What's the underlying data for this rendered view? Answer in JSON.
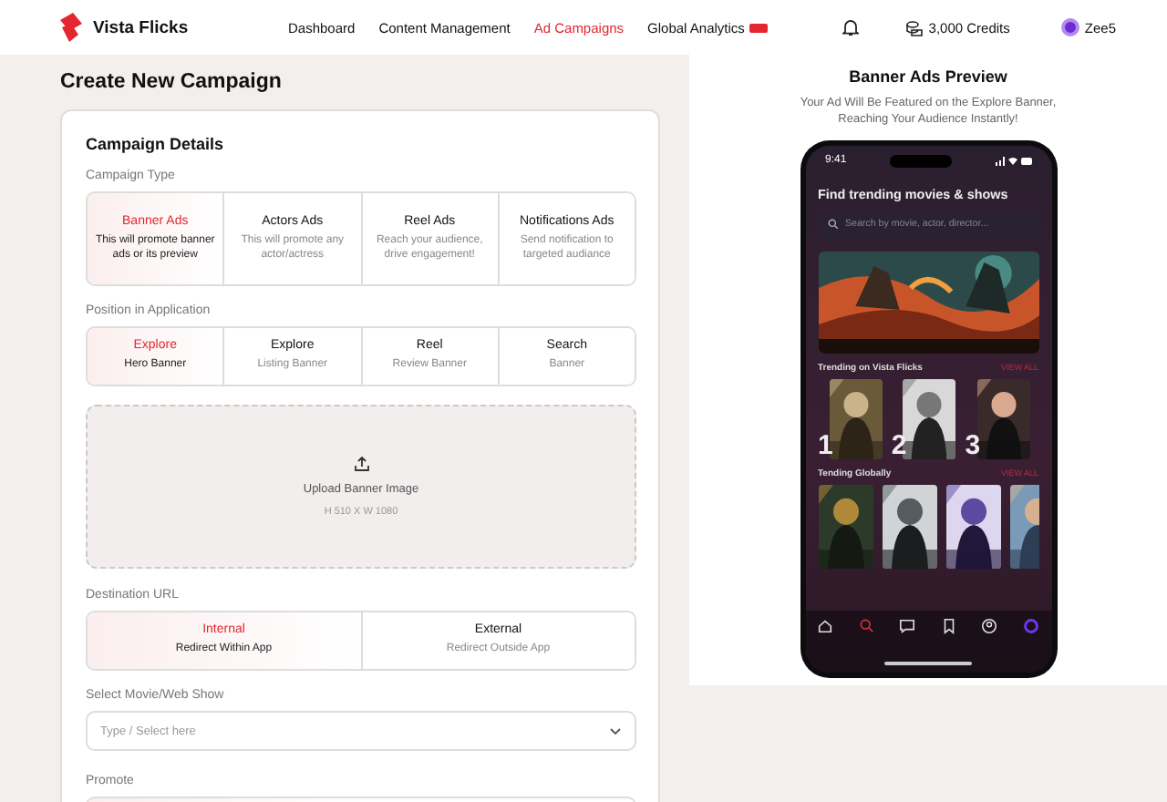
{
  "header": {
    "brand": "Vista Flicks",
    "nav": [
      {
        "label": "Dashboard",
        "selected": false,
        "badge": false
      },
      {
        "label": "Content Management",
        "selected": false,
        "badge": false
      },
      {
        "label": "Ad Campaigns",
        "selected": true,
        "badge": false
      },
      {
        "label": "Global Analytics",
        "selected": false,
        "badge": true
      }
    ],
    "credits": "3,000 Credits",
    "user": "Zee5"
  },
  "page_title": "Create New Campaign",
  "form": {
    "title": "Campaign Details",
    "campaign_type": {
      "label": "Campaign Type",
      "options": [
        {
          "title": "Banner Ads",
          "description": "This will promote banner ads or its preview",
          "selected": true
        },
        {
          "title": "Actors Ads",
          "description": "This will promote any actor/actress",
          "selected": false
        },
        {
          "title": "Reel Ads",
          "description": "Reach your audience, drive engagement!",
          "selected": false
        },
        {
          "title": "Notifications Ads",
          "description": "Send notification to targeted audiance",
          "selected": false
        }
      ]
    },
    "position": {
      "label": "Position in Application",
      "options": [
        {
          "title": "Explore",
          "description": "Hero Banner",
          "selected": true
        },
        {
          "title": "Explore",
          "description": "Listing Banner",
          "selected": false
        },
        {
          "title": "Reel",
          "description": "Review Banner",
          "selected": false
        },
        {
          "title": "Search",
          "description": "Banner",
          "selected": false
        }
      ]
    },
    "upload": {
      "label": "Upload Banner Image",
      "hint": "H 510 X W 1080"
    },
    "destination": {
      "label": "Destination URL",
      "options": [
        {
          "title": "Internal",
          "description": "Redirect Within App",
          "selected": true
        },
        {
          "title": "External",
          "description": "Redirect Outside App",
          "selected": false
        }
      ]
    },
    "select": {
      "label": "Select Movie/Web Show",
      "placeholder": "Type / Select here"
    },
    "promote": {
      "label": "Promote"
    }
  },
  "preview": {
    "title": "Banner Ads Preview",
    "subtitle": "Your Ad Will Be Featured on the Explore Banner, Reaching Your Audience Instantly!",
    "phone": {
      "time": "9:41",
      "heading": "Find trending movies & shows",
      "search_placeholder": "Search by movie, actor, director...",
      "sections": [
        {
          "title": "Trending on Vista Flicks",
          "action": "VIEW ALL",
          "items": [
            {
              "rank": "1"
            },
            {
              "rank": "2"
            },
            {
              "rank": "3"
            }
          ]
        },
        {
          "title": "Tending Globally",
          "action": "VIEW ALL"
        }
      ],
      "tabs": [
        {
          "kind": "home",
          "selected": false
        },
        {
          "kind": "search",
          "selected": true
        },
        {
          "kind": "chat",
          "selected": false
        },
        {
          "kind": "bookmark",
          "selected": false
        },
        {
          "kind": "profile",
          "selected": false
        },
        {
          "kind": "avatar",
          "selected": false
        }
      ]
    }
  }
}
